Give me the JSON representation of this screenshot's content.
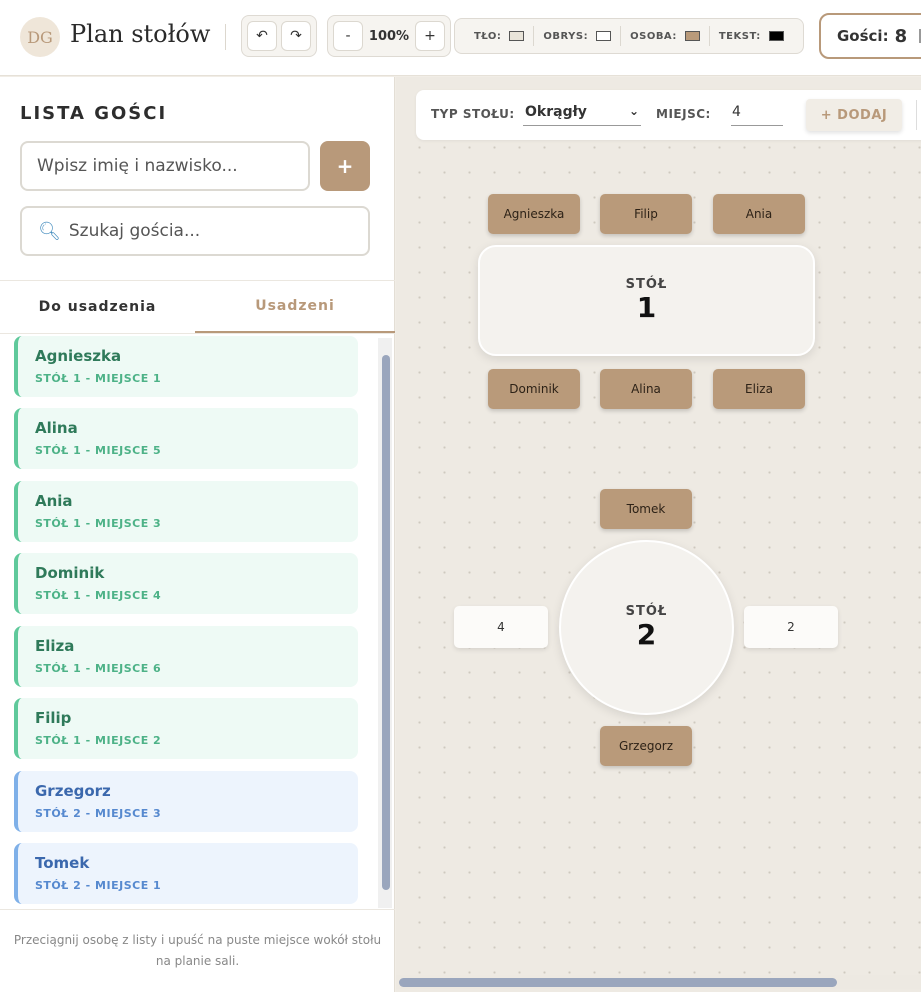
{
  "header": {
    "logo_text": "DG",
    "title": "Plan stołów",
    "undo_icon": "↶",
    "redo_icon": "↷",
    "zoom_out": "-",
    "zoom_level": "100%",
    "zoom_in": "+",
    "colors": [
      {
        "label": "TŁO:",
        "color": "#e9e4d9"
      },
      {
        "label": "OBRYS:",
        "color": "#ffffff"
      },
      {
        "label": "OSOBA:",
        "color": "#b99a7a"
      },
      {
        "label": "TEKST:",
        "color": "#000000"
      }
    ],
    "guests_label": "Gości:",
    "guests_count": "8"
  },
  "sidebar": {
    "title": "LISTA GOŚCI",
    "name_placeholder": "Wpisz imię i nazwisko...",
    "add_button": "+",
    "search_placeholder": "Szukaj gościa...",
    "tabs": [
      {
        "label": "Do usadzenia",
        "active": false
      },
      {
        "label": "Usadzeni",
        "active": true
      }
    ],
    "guests": [
      {
        "name": "Agnieszka",
        "seat": "STÓŁ 1 - MIEJSCE 1",
        "table": 1
      },
      {
        "name": "Alina",
        "seat": "STÓŁ 1 - MIEJSCE 5",
        "table": 1
      },
      {
        "name": "Ania",
        "seat": "STÓŁ 1 - MIEJSCE 3",
        "table": 1
      },
      {
        "name": "Dominik",
        "seat": "STÓŁ 1 - MIEJSCE 4",
        "table": 1
      },
      {
        "name": "Eliza",
        "seat": "STÓŁ 1 - MIEJSCE 6",
        "table": 1
      },
      {
        "name": "Filip",
        "seat": "STÓŁ 1 - MIEJSCE 2",
        "table": 1
      },
      {
        "name": "Grzegorz",
        "seat": "STÓŁ 2 - MIEJSCE 3",
        "table": 2
      },
      {
        "name": "Tomek",
        "seat": "STÓŁ 2 - MIEJSCE 1",
        "table": 2
      }
    ],
    "help_text": "Przeciągnij osobę z listy i upuść na puste miejsce wokół stołu na planie sali."
  },
  "toolbar": {
    "type_label": "TYP STOŁU:",
    "type_value": "Okrągły",
    "seats_label": "MIEJSC:",
    "seats_value": "4",
    "add_label": "+ DODAJ"
  },
  "tables": [
    {
      "label": "STÓŁ",
      "number": "1",
      "shape": "rectangle",
      "top_seats": [
        "Agnieszka",
        "Filip",
        "Ania"
      ],
      "bottom_seats": [
        "Dominik",
        "Alina",
        "Eliza"
      ]
    },
    {
      "label": "STÓŁ",
      "number": "2",
      "shape": "round",
      "top_seat": "Tomek",
      "right_seat": "2",
      "bottom_seat": "Grzegorz",
      "left_seat": "4"
    }
  ]
}
